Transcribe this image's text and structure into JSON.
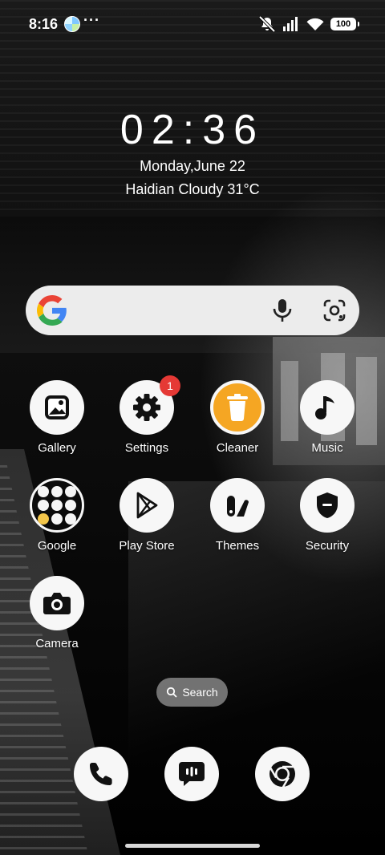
{
  "status_bar": {
    "time": "8:16",
    "overflow": "···",
    "battery": "100",
    "icons": [
      "app-notification-icon",
      "mute-icon",
      "signal-icon",
      "wifi-icon",
      "battery-icon"
    ]
  },
  "clock_widget": {
    "time": "02:36",
    "date": "Monday,June 22",
    "weather": "Haidian Cloudy 31°C"
  },
  "search_widget": {
    "icons": [
      "google-logo",
      "mic-icon",
      "lens-icon"
    ]
  },
  "apps": [
    {
      "label": "Gallery",
      "icon": "gallery-icon"
    },
    {
      "label": "Settings",
      "icon": "gear-icon",
      "badge": "1"
    },
    {
      "label": "Cleaner",
      "icon": "trash-icon",
      "color": "#f5a623"
    },
    {
      "label": "Music",
      "icon": "music-note-icon"
    },
    {
      "label": "Google",
      "icon": "google-folder-icon"
    },
    {
      "label": "Play Store",
      "icon": "play-store-icon"
    },
    {
      "label": "Themes",
      "icon": "themes-icon"
    },
    {
      "label": "Security",
      "icon": "shield-icon"
    },
    {
      "label": "Camera",
      "icon": "camera-icon"
    }
  ],
  "app_search": {
    "label": "Search"
  },
  "dock": [
    {
      "name": "Phone",
      "icon": "phone-icon"
    },
    {
      "name": "Messages",
      "icon": "message-icon"
    },
    {
      "name": "Chrome",
      "icon": "chrome-icon"
    }
  ],
  "colors": {
    "badge": "#e53935",
    "cleaner": "#f5a623",
    "search_bar": "#ececec"
  }
}
